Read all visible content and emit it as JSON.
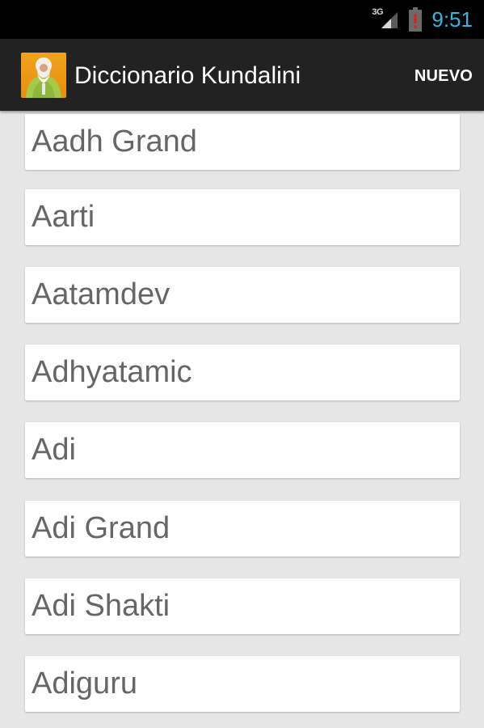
{
  "status_bar": {
    "network_type": "3G",
    "time": "9:51",
    "icons": [
      "signal-icon",
      "battery-alert-icon"
    ],
    "clock_color": "#33b5e5",
    "battery_alert_color": "#e02020"
  },
  "action_bar": {
    "title": "Diccionario Kundalini",
    "new_button_label": "NUEVO",
    "app_icon": "yogi-app-icon"
  },
  "terms": {
    "items": [
      {
        "label": "Aadh Grand"
      },
      {
        "label": "Aarti"
      },
      {
        "label": "Aatamdev"
      },
      {
        "label": "Adhyatamic"
      },
      {
        "label": "Adi"
      },
      {
        "label": "Adi Grand"
      },
      {
        "label": "Adi Shakti"
      },
      {
        "label": "Adiguru"
      }
    ]
  }
}
